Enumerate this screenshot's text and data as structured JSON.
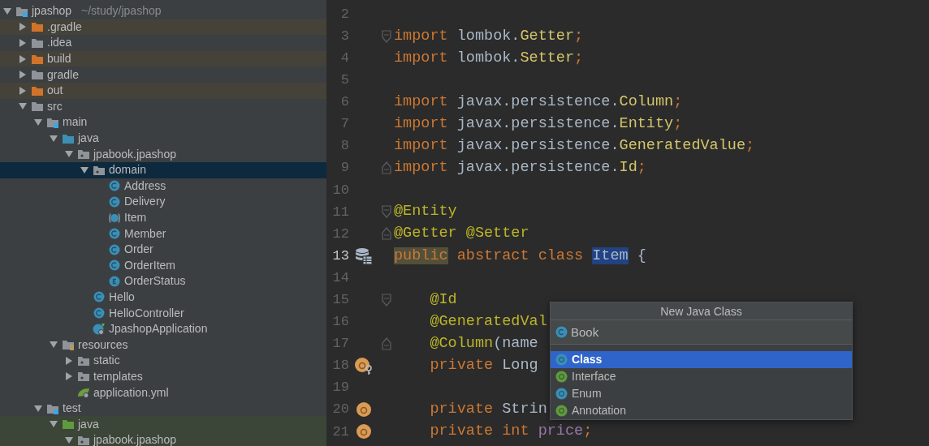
{
  "project_tree": [
    {
      "label": "jpashop",
      "path": "~/study/jpashop",
      "kind": "module",
      "expanded": true,
      "selected": false,
      "children": [
        {
          "label": ".gradle",
          "kind": "excluded",
          "expanded": false,
          "selected": false
        },
        {
          "label": ".idea",
          "kind": "plain",
          "expanded": false,
          "selected": false
        },
        {
          "label": "build",
          "kind": "excluded",
          "expanded": false,
          "selected": false
        },
        {
          "label": "gradle",
          "kind": "plain",
          "expanded": false,
          "selected": false
        },
        {
          "label": "out",
          "kind": "excluded",
          "expanded": false,
          "selected": false
        },
        {
          "label": "src",
          "kind": "plain",
          "expanded": true,
          "selected": false,
          "children": [
            {
              "label": "main",
              "kind": "module",
              "expanded": true,
              "selected": false,
              "children": [
                {
                  "label": "java",
                  "kind": "source",
                  "expanded": true,
                  "selected": false,
                  "children": [
                    {
                      "label": "jpabook.jpashop",
                      "kind": "package",
                      "expanded": true,
                      "selected": false,
                      "children": [
                        {
                          "label": "domain",
                          "kind": "package",
                          "expanded": true,
                          "selected": true,
                          "children": [
                            {
                              "label": "Address",
                              "kind": "class",
                              "selected": false
                            },
                            {
                              "label": "Delivery",
                              "kind": "class",
                              "selected": false
                            },
                            {
                              "label": "Item",
                              "kind": "abstract_class",
                              "selected": false
                            },
                            {
                              "label": "Member",
                              "kind": "class",
                              "selected": false
                            },
                            {
                              "label": "Order",
                              "kind": "class",
                              "selected": false
                            },
                            {
                              "label": "OrderItem",
                              "kind": "class",
                              "selected": false
                            },
                            {
                              "label": "OrderStatus",
                              "kind": "enum",
                              "selected": false
                            }
                          ]
                        },
                        {
                          "label": "Hello",
                          "kind": "class",
                          "selected": false
                        },
                        {
                          "label": "HelloController",
                          "kind": "class",
                          "selected": false
                        },
                        {
                          "label": "JpashopApplication",
                          "kind": "spring_app",
                          "selected": false
                        }
                      ]
                    }
                  ]
                },
                {
                  "label": "resources",
                  "kind": "resources",
                  "expanded": true,
                  "selected": false,
                  "children": [
                    {
                      "label": "static",
                      "kind": "package",
                      "expanded": false,
                      "selected": false
                    },
                    {
                      "label": "templates",
                      "kind": "package",
                      "expanded": false,
                      "selected": false
                    },
                    {
                      "label": "application.yml",
                      "kind": "yml",
                      "selected": false
                    }
                  ]
                }
              ]
            },
            {
              "label": "test",
              "kind": "module",
              "expanded": true,
              "selected": false,
              "children": [
                {
                  "label": "java",
                  "kind": "test_source",
                  "expanded": true,
                  "selected": false,
                  "children": [
                    {
                      "label": "jpabook.jpashop",
                      "kind": "package",
                      "expanded": true,
                      "selected": false
                    }
                  ]
                }
              ]
            }
          ]
        }
      ]
    }
  ],
  "code_lines": [
    {
      "number": "2",
      "current": false
    },
    {
      "number": "3",
      "current": false,
      "fold_marker": {
        "kind": "start"
      },
      "segments": [
        {
          "text": "import",
          "kind": "keyword"
        },
        {
          "text": " lombok.",
          "kind": "plain"
        },
        {
          "text": "Getter",
          "kind": "type"
        },
        {
          "text": ";",
          "kind": "keyword"
        }
      ]
    },
    {
      "number": "4",
      "current": false,
      "segments": [
        {
          "text": "import",
          "kind": "keyword"
        },
        {
          "text": " lombok.",
          "kind": "plain"
        },
        {
          "text": "Setter",
          "kind": "type"
        },
        {
          "text": ";",
          "kind": "keyword"
        }
      ]
    },
    {
      "number": "5",
      "current": false
    },
    {
      "number": "6",
      "current": false,
      "segments": [
        {
          "text": "import",
          "kind": "keyword"
        },
        {
          "text": " javax.persistence.",
          "kind": "plain"
        },
        {
          "text": "Column",
          "kind": "type"
        },
        {
          "text": ";",
          "kind": "keyword"
        }
      ]
    },
    {
      "number": "7",
      "current": false,
      "segments": [
        {
          "text": "import",
          "kind": "keyword"
        },
        {
          "text": " javax.persistence.",
          "kind": "plain"
        },
        {
          "text": "Entity",
          "kind": "type"
        },
        {
          "text": ";",
          "kind": "keyword"
        }
      ]
    },
    {
      "number": "8",
      "current": false,
      "segments": [
        {
          "text": "import",
          "kind": "keyword"
        },
        {
          "text": " javax.persistence.",
          "kind": "plain"
        },
        {
          "text": "GeneratedValue",
          "kind": "type"
        },
        {
          "text": ";",
          "kind": "keyword"
        }
      ]
    },
    {
      "number": "9",
      "current": false,
      "fold_marker": {
        "kind": "end"
      },
      "segments": [
        {
          "text": "import",
          "kind": "keyword"
        },
        {
          "text": " javax.persistence.",
          "kind": "plain"
        },
        {
          "text": "Id",
          "kind": "type"
        },
        {
          "text": ";",
          "kind": "keyword"
        }
      ]
    },
    {
      "number": "10",
      "current": false
    },
    {
      "number": "11",
      "current": false,
      "fold_marker": {
        "kind": "start"
      },
      "segments": [
        {
          "text": "@Entity",
          "kind": "annotation"
        }
      ]
    },
    {
      "number": "12",
      "current": false,
      "fold_marker": {
        "kind": "end"
      },
      "segments": [
        {
          "text": "@Getter @Setter",
          "kind": "annotation"
        }
      ]
    },
    {
      "number": "13",
      "current": true,
      "gutter_icon": {
        "kind": "database"
      },
      "segments": [
        {
          "text": "public",
          "kind": "keyword",
          "highlight": {
            "kind": "usage"
          }
        },
        {
          "text": " abstract class ",
          "kind": "keyword"
        },
        {
          "text": "Item",
          "kind": "plain",
          "highlight": {
            "kind": "selection"
          }
        },
        {
          "text": " {",
          "kind": "plain"
        }
      ]
    },
    {
      "number": "14",
      "current": false
    },
    {
      "number": "15",
      "current": false,
      "fold_marker": {
        "kind": "start"
      },
      "segments": [
        {
          "text": "    @Id",
          "kind": "annotation"
        }
      ]
    },
    {
      "number": "16",
      "current": false,
      "segments": [
        {
          "text": "    @GeneratedVal",
          "kind": "annotation"
        }
      ]
    },
    {
      "number": "17",
      "current": false,
      "fold_marker": {
        "kind": "end"
      },
      "segments": [
        {
          "text": "    @Column",
          "kind": "annotation"
        },
        {
          "text": "(name",
          "kind": "plain"
        }
      ]
    },
    {
      "number": "18",
      "current": false,
      "gutter_icon": {
        "kind": "field_key"
      },
      "segments": [
        {
          "text": "    private",
          "kind": "keyword"
        },
        {
          "text": " Long",
          "kind": "plain"
        }
      ]
    },
    {
      "number": "19",
      "current": false
    },
    {
      "number": "20",
      "current": false,
      "gutter_icon": {
        "kind": "field"
      },
      "segments": [
        {
          "text": "    private",
          "kind": "keyword"
        },
        {
          "text": " Strin",
          "kind": "plain"
        }
      ]
    },
    {
      "number": "21",
      "current": false,
      "gutter_icon": {
        "kind": "field"
      },
      "segments": [
        {
          "text": "    private int",
          "kind": "keyword"
        },
        {
          "text": " price",
          "kind": "field"
        },
        {
          "text": ";",
          "kind": "keyword"
        }
      ]
    }
  ],
  "new_class_popup": {
    "title": "New Java Class",
    "name_value": "Book",
    "options": [
      {
        "label": "Class",
        "kind": "class",
        "selected": true
      },
      {
        "label": "Interface",
        "kind": "interface",
        "selected": false
      },
      {
        "label": "Enum",
        "kind": "enum",
        "selected": false
      },
      {
        "label": "Annotation",
        "kind": "annotation",
        "selected": false
      }
    ]
  }
}
